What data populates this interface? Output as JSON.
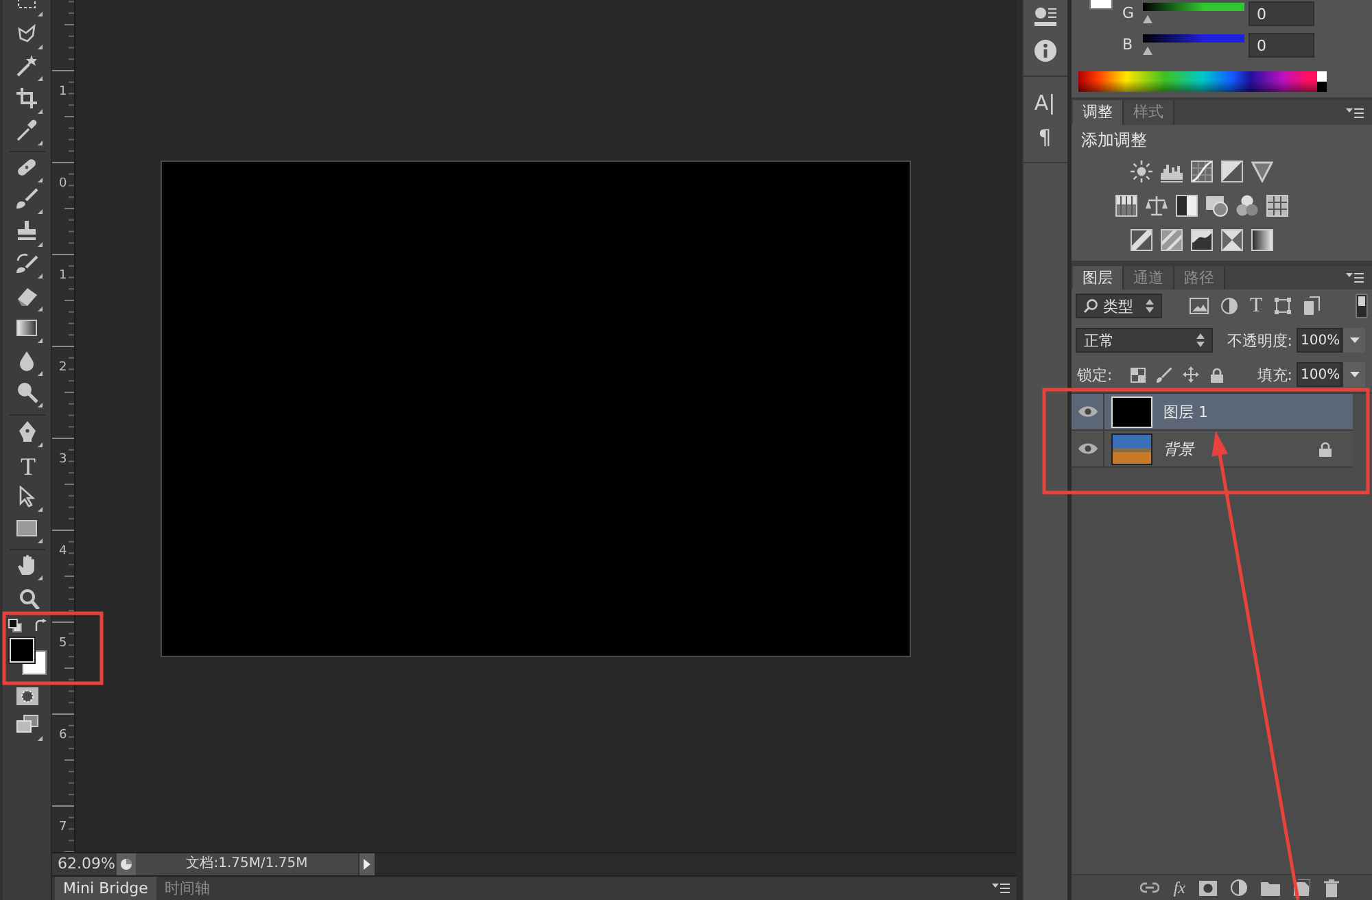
{
  "toolbar": {
    "type_tool": "T",
    "swatches": [
      {
        "color": "#000000"
      },
      {
        "color": "#ffffff"
      }
    ]
  },
  "ruler": {
    "labels": [
      "1",
      "0",
      "1",
      "2",
      "3",
      "4",
      "5",
      "6",
      "7"
    ]
  },
  "status_bar": {
    "zoom": "62.09%",
    "doc_info": "文档:1.75M/1.75M"
  },
  "bottom_tabs": [
    {
      "label": "Mini Bridge",
      "selected": true
    },
    {
      "label": "时间轴",
      "selected": false
    }
  ],
  "dock": {
    "character_button": "A|",
    "paragraph_button": "¶"
  },
  "color_panel": {
    "swatch": {
      "color": "#ffffff"
    },
    "sliders": [
      {
        "label": "G",
        "color": "#30c830",
        "level": 0,
        "value": "0"
      },
      {
        "label": "B",
        "color": "#2020e0",
        "level": 0,
        "value": "0"
      }
    ]
  },
  "adjustments_panel": {
    "tabs": [
      {
        "label": "调整",
        "selected": true
      },
      {
        "label": "样式",
        "selected": false
      }
    ],
    "heading": "添加调整"
  },
  "layers_panel": {
    "tabs": [
      {
        "label": "图层",
        "selected": true
      },
      {
        "label": "通道",
        "selected": false
      },
      {
        "label": "路径",
        "selected": false
      }
    ],
    "filter": {
      "value": "类型",
      "type_glyph": "T",
      "on": true
    },
    "blend_mode": "正常",
    "opacity_label": "不透明度:",
    "opacity": "100%",
    "lock_label": "锁定:",
    "fill_label": "填充:",
    "fill": "100%",
    "layers": [
      {
        "name": "图层 1",
        "kind": "solid",
        "selected": true,
        "visible": true,
        "locked": false
      },
      {
        "name": "背景",
        "kind": "photo",
        "selected": false,
        "visible": true,
        "locked": true
      }
    ],
    "effects_button": "fx"
  }
}
